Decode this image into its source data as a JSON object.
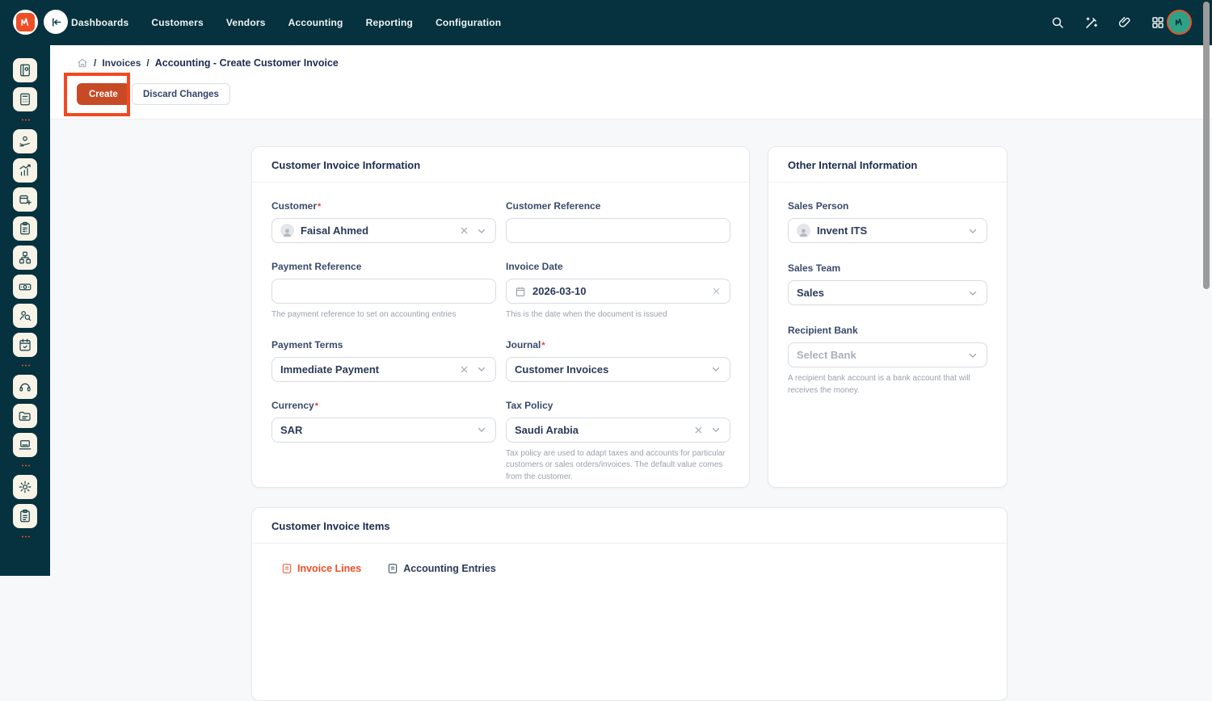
{
  "topnav": {
    "menu": [
      "Dashboards",
      "Customers",
      "Vendors",
      "Accounting",
      "Reporting",
      "Configuration"
    ],
    "icons": [
      "search-icon",
      "magic-wand-icon",
      "paperclip-icon",
      "apps-grid-icon",
      "user-avatar"
    ]
  },
  "sidebar": {
    "icons": [
      "journal-book",
      "calculator",
      "hand-coins",
      "growth-chart",
      "box-add",
      "clipboard-calculator",
      "linked-boxes",
      "cash",
      "person-search",
      "calendar-check",
      "headset",
      "folder-document",
      "laptop",
      "gear",
      "clipboard-list"
    ]
  },
  "breadcrumb": {
    "level1": "Invoices",
    "separator": "/",
    "current": "Accounting - Create Customer Invoice"
  },
  "toolbar": {
    "create_label": "Create",
    "discard_label": "Discard Changes"
  },
  "invoice_info": {
    "title": "Customer Invoice Information",
    "customer": {
      "label": "Customer",
      "value": "Faisal Ahmed"
    },
    "customer_reference": {
      "label": "Customer Reference",
      "value": ""
    },
    "payment_reference": {
      "label": "Payment Reference",
      "value": "",
      "help": "The payment reference to set on accounting entries"
    },
    "invoice_date": {
      "label": "Invoice Date",
      "value": "2026-03-10",
      "help": "This is the date when the document is issued"
    },
    "payment_terms": {
      "label": "Payment Terms",
      "value": "Immediate Payment"
    },
    "journal": {
      "label": "Journal",
      "value": "Customer Invoices"
    },
    "currency": {
      "label": "Currency",
      "value": "SAR"
    },
    "tax_policy": {
      "label": "Tax Policy",
      "value": "Saudi Arabia",
      "help": "Tax policy are used to adapt taxes and accounts for particular customers or sales orders/invoices. The default value comes from the customer."
    }
  },
  "other_info": {
    "title": "Other Internal Information",
    "sales_person": {
      "label": "Sales Person",
      "value": "Invent ITS"
    },
    "sales_team": {
      "label": "Sales Team",
      "value": "Sales"
    },
    "recipient_bank": {
      "label": "Recipient Bank",
      "placeholder": "Select Bank",
      "help": "A recipient bank account is a bank account that will receives the money."
    }
  },
  "invoice_items": {
    "title": "Customer Invoice Items",
    "tabs": [
      "Invoice Lines",
      "Accounting Entries"
    ]
  },
  "colors": {
    "navbar_teal": "#05323e",
    "accent_orange": "#f3481f",
    "create_button": "#c74a27",
    "label_navy": "#3a4a6b",
    "icon_tile_cream": "#f7f3e7"
  }
}
